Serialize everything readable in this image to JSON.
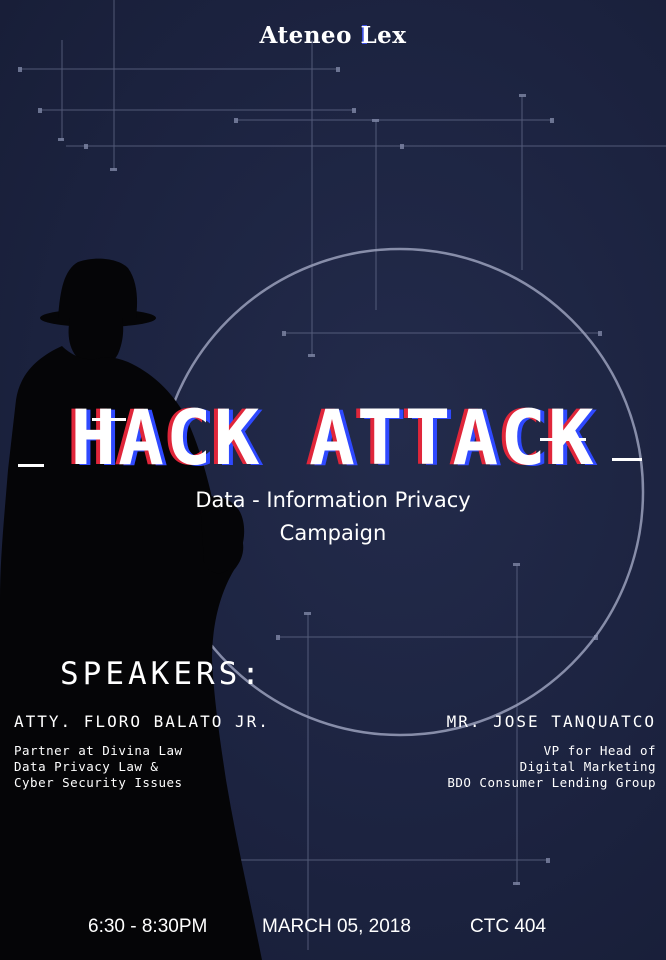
{
  "logo": {
    "part1": "Ateneo",
    "part2_initial": "L",
    "part2_rest": "ex"
  },
  "title": "HACK ATTACK",
  "subtitle": {
    "line1": "Data - Information Privacy",
    "line2": "Campaign"
  },
  "speakers": {
    "heading": "SPEAKERS:",
    "left": {
      "name": "ATTY. FLORO BALATO JR.",
      "role": [
        "Partner at Divina Law",
        "Data Privacy Law &",
        "Cyber Security Issues"
      ]
    },
    "right": {
      "name": "MR. JOSE TANQUATCO",
      "role": [
        "VP for Head of",
        "Digital Marketing",
        "BDO Consumer Lending Group"
      ]
    }
  },
  "event": {
    "time": "6:30 - 8:30PM",
    "date": "MARCH 05, 2018",
    "venue": "CTC 404"
  },
  "colors": {
    "background": "#1d2440",
    "glitch_red": "#e0263a",
    "glitch_blue": "#2f49ff",
    "text": "#ffffff"
  }
}
